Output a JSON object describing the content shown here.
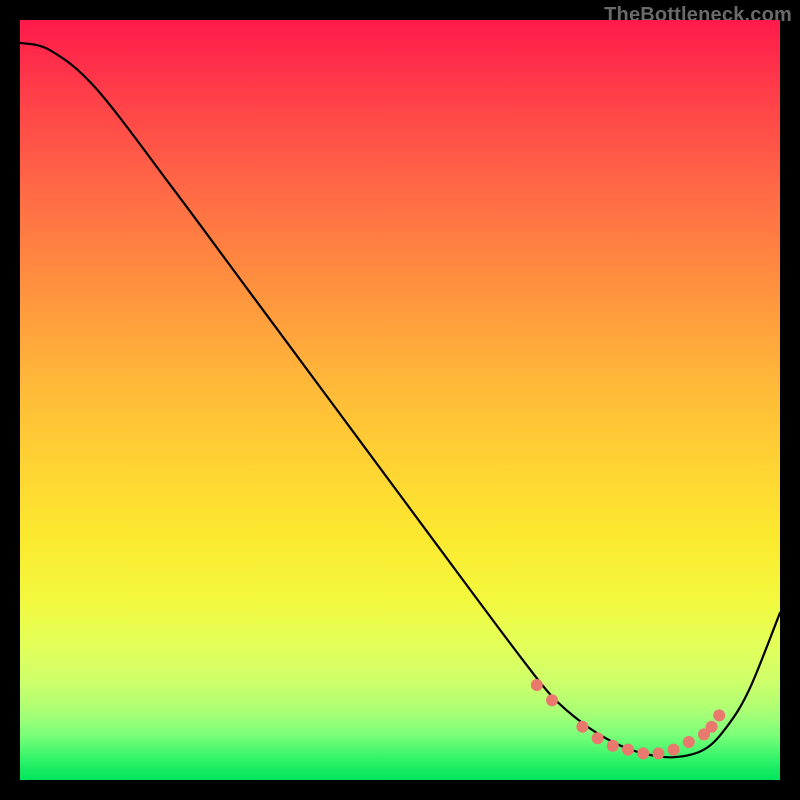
{
  "watermark": "TheBottleneck.com",
  "chart_data": {
    "type": "line",
    "title": "",
    "xlabel": "",
    "ylabel": "",
    "xlim": [
      0,
      100
    ],
    "ylim": [
      0,
      100
    ],
    "grid": false,
    "series": [
      {
        "name": "curve",
        "color": "#000000",
        "x": [
          0,
          4,
          10,
          20,
          30,
          40,
          50,
          60,
          66,
          70,
          74,
          78,
          82,
          86,
          90,
          93,
          96,
          100
        ],
        "y": [
          97,
          96,
          91,
          78,
          64.5,
          51,
          37.5,
          24,
          16,
          11,
          7.5,
          5,
          3.5,
          3,
          4,
          7,
          12,
          22
        ]
      }
    ],
    "markers": [
      {
        "x": 68,
        "y": 12.5
      },
      {
        "x": 70,
        "y": 10.5
      },
      {
        "x": 74,
        "y": 7
      },
      {
        "x": 76,
        "y": 5.5
      },
      {
        "x": 78,
        "y": 4.5
      },
      {
        "x": 80,
        "y": 4
      },
      {
        "x": 82,
        "y": 3.5
      },
      {
        "x": 84,
        "y": 3.5
      },
      {
        "x": 86,
        "y": 4
      },
      {
        "x": 88,
        "y": 5
      },
      {
        "x": 90,
        "y": 6
      },
      {
        "x": 91,
        "y": 7
      },
      {
        "x": 92,
        "y": 8.5
      }
    ],
    "marker_style": {
      "color": "#e9786d",
      "radius": 6
    }
  }
}
